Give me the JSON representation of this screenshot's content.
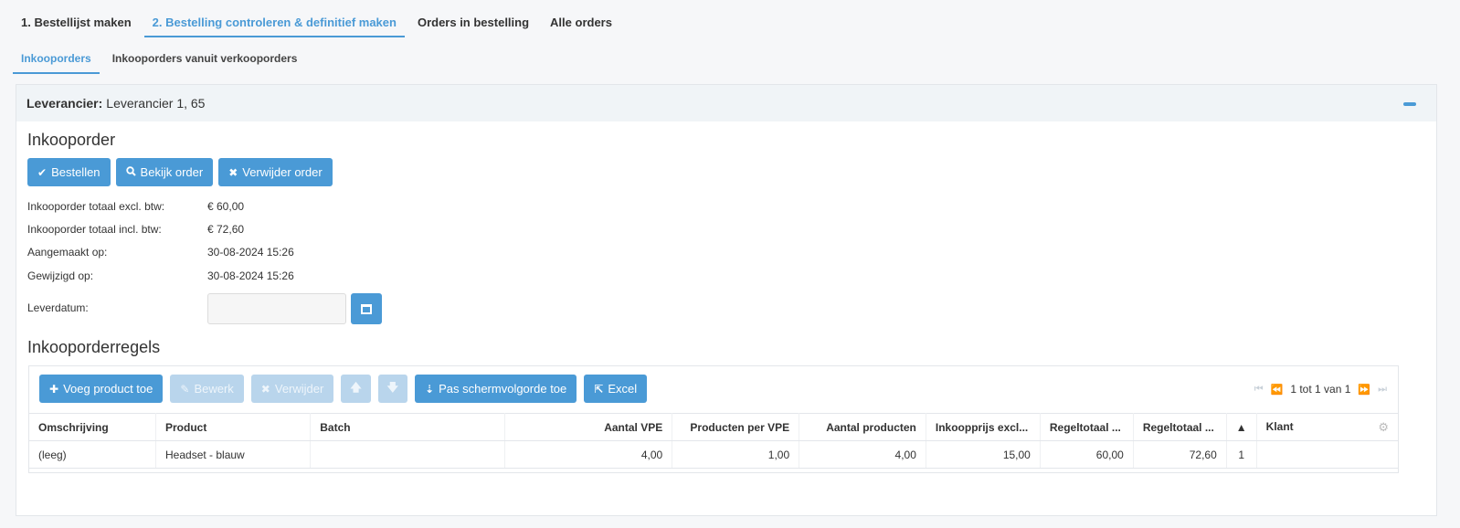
{
  "main_tabs": [
    "1. Bestellijst maken",
    "2. Bestelling controleren & definitief maken",
    "Orders in bestelling",
    "Alle orders"
  ],
  "sub_tabs": [
    "Inkooporders",
    "Inkooporders vanuit verkooporders"
  ],
  "panel": {
    "supplier_label": "Leverancier:",
    "supplier_value": "Leverancier 1, 65"
  },
  "order": {
    "title": "Inkooporder",
    "buttons": {
      "bestellen": "Bestellen",
      "bekijk": "Bekijk order",
      "verwijder": "Verwijder order"
    },
    "info": [
      {
        "label": "Inkooporder totaal excl. btw:",
        "value": "€ 60,00"
      },
      {
        "label": "Inkooporder totaal incl. btw:",
        "value": "€ 72,60"
      },
      {
        "label": "Aangemaakt op:",
        "value": "30-08-2024 15:26"
      },
      {
        "label": "Gewijzigd op:",
        "value": "30-08-2024 15:26"
      }
    ],
    "delivery_label": "Leverdatum:",
    "delivery_value": ""
  },
  "lines": {
    "title": "Inkooporderregels",
    "toolbar": {
      "add": "Voeg product toe",
      "edit": "Bewerk",
      "delete": "Verwijder",
      "sort": "Pas schermvolgorde toe",
      "excel": "Excel"
    },
    "pager": "1 tot 1 van 1",
    "columns": [
      "Omschrijving",
      "Product",
      "Batch",
      "Aantal VPE",
      "Producten per VPE",
      "Aantal producten",
      "Inkoopprijs excl...",
      "Regeltotaal ...",
      "Regeltotaal ...",
      "▲",
      "Klant"
    ],
    "rows": [
      [
        "(leeg)",
        "Headset - blauw",
        "",
        "4,00",
        "1,00",
        "4,00",
        "15,00",
        "60,00",
        "72,60",
        "1",
        ""
      ]
    ]
  }
}
